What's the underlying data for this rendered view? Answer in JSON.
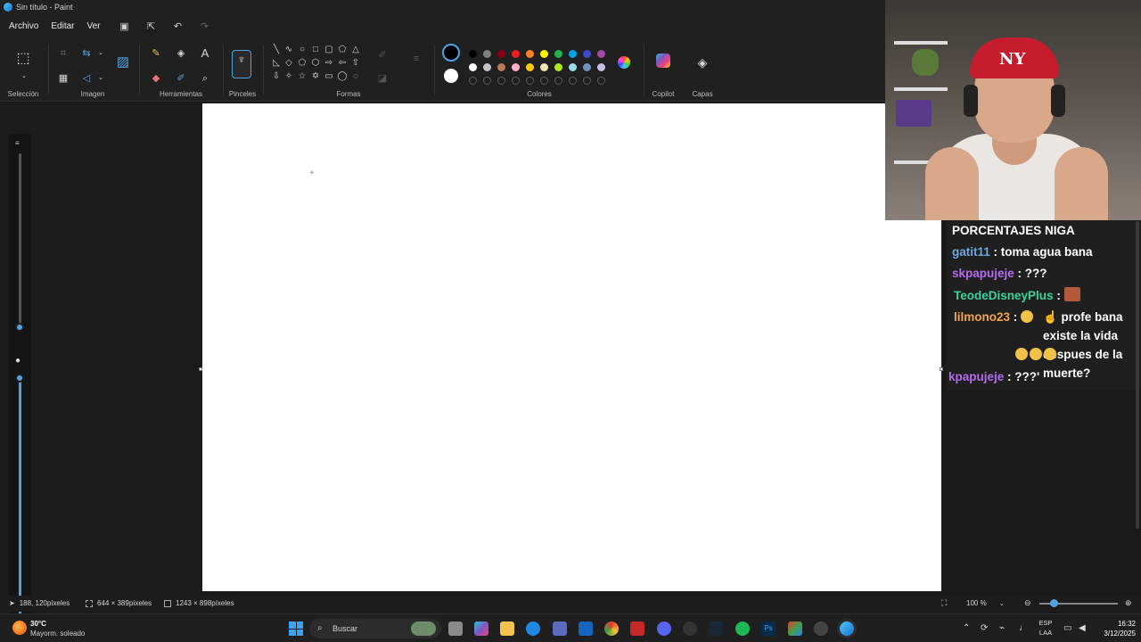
{
  "window": {
    "title": "Sin título - Paint"
  },
  "menu": {
    "items": [
      "Archivo",
      "Editar",
      "Ver"
    ],
    "quick_actions": [
      {
        "name": "save",
        "icon": "save-icon",
        "glyph": "🖫"
      },
      {
        "name": "share",
        "icon": "share-icon",
        "glyph": "⇪"
      },
      {
        "name": "undo",
        "icon": "undo-icon",
        "glyph": "↶"
      },
      {
        "name": "redo",
        "icon": "redo-icon",
        "glyph": "↷"
      }
    ]
  },
  "ribbon": {
    "groups": {
      "seleccion": "Selección",
      "imagen": "Imagen",
      "herramientas": "Herramientas",
      "pinceles": "Pinceles",
      "formas": "Formas",
      "colores": "Colores",
      "copilot": "Copilot",
      "capas": "Capas"
    },
    "colors": {
      "primary": "#000000",
      "secondary": "#ffffff",
      "row1": [
        "#000000",
        "#7f7f7f",
        "#880015",
        "#ed1c24",
        "#ff7f27",
        "#fff200",
        "#22b14c",
        "#00a2e8",
        "#3f48cc",
        "#a349a4"
      ],
      "row2": [
        "#ffffff",
        "#c3c3c3",
        "#b97a57",
        "#ffaec9",
        "#ffc90e",
        "#efe4b0",
        "#b5e61d",
        "#99d9ea",
        "#7092be",
        "#c8bfe7"
      ]
    }
  },
  "status": {
    "cursor_pos": "188, 120píxeles",
    "selection_size": "644 × 389píxeles",
    "canvas_size": "1243 × 898píxeles",
    "zoom": "100 %"
  },
  "chat": {
    "title": "PORCENTAJES NIGA",
    "messages": [
      {
        "user": "gatit11",
        "text": ": toma agua bana"
      },
      {
        "user": "skpapujeje",
        "text": ": ???"
      },
      {
        "user": "TeodeDisneyPlus",
        "text": ":"
      },
      {
        "user": "lilmono23",
        "text": ":"
      },
      {
        "user": "",
        "text": "☝ profe bana existe la vida despues de la muerte?"
      },
      {
        "user": "kpapujeje",
        "text": ": ???'"
      }
    ]
  },
  "taskbar": {
    "weather_temp": "30°C",
    "weather_desc": "Mayorm. soleado",
    "search_placeholder": "Buscar",
    "lang_top": "ESP",
    "lang_bottom": "LAA",
    "time": "16:32",
    "date": "3/12/2025"
  }
}
